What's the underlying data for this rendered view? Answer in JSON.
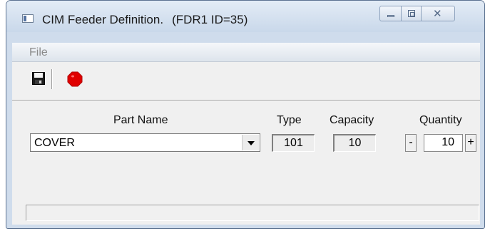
{
  "window": {
    "title": "CIM Feeder Definition.",
    "title_detail": "(FDR1  ID=35)",
    "controls": {
      "minimize_icon": "minimize-icon",
      "maximize_icon": "maximize-icon",
      "close_glyph": "✕"
    }
  },
  "menu": {
    "items": [
      {
        "label": "File"
      }
    ]
  },
  "toolbar": {
    "save_icon": "floppy-disk-icon",
    "stop_icon": "stop-sign-icon",
    "stop_color": "#e00000"
  },
  "form": {
    "part_name": {
      "label": "Part Name",
      "value": "COVER"
    },
    "type": {
      "label": "Type",
      "value": "101"
    },
    "capacity": {
      "label": "Capacity",
      "value": "10"
    },
    "quantity": {
      "label": "Quantity",
      "value": "10",
      "decrement_label": "-",
      "increment_label": "+"
    }
  },
  "status": {
    "text": ""
  }
}
